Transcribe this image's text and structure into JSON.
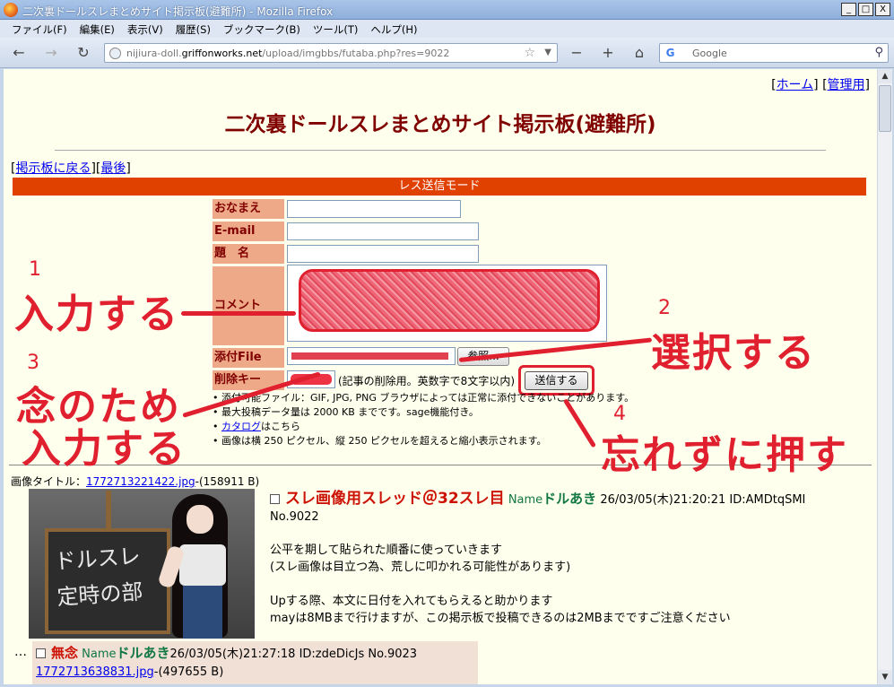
{
  "window": {
    "title": "二次裏ドールスレまとめサイト掲示板(避難所) - Mozilla Firefox",
    "minimize": "_",
    "maximize": "□",
    "close": "X"
  },
  "menu": [
    "ファイル(F)",
    "編集(E)",
    "表示(V)",
    "履歴(S)",
    "ブックマーク(B)",
    "ツール(T)",
    "ヘルプ(H)"
  ],
  "nav": {
    "url_prefix": "nijiura-doll.",
    "url_host": "griffonworks.net",
    "url_path": "/upload/imgbbs/futaba.php?res=9022",
    "search_placeholder": "Google",
    "back": "←",
    "forward": "→",
    "reload": "↻",
    "zoom_out": "−",
    "zoom_in": "+",
    "home": "⌂"
  },
  "page": {
    "home_link": "ホーム",
    "admin_link": "管理用",
    "title": "二次裏ドールスレまとめサイト掲示板(避難所)",
    "back_link": "掲示板に戻る",
    "last_link": "最後",
    "mode_bar": "レス送信モード"
  },
  "form": {
    "name_label": "おなまえ",
    "email_label": "E-mail",
    "subject_label": "題　名",
    "comment_label": "コメント",
    "file_label": "添付File",
    "browse_button": "参照...",
    "password_label": "削除キー",
    "password_note": "(記事の削除用。英数字で8文字以内)",
    "submit_button": "送信する",
    "notes": [
      "添付可能ファイル：GIF, JPG, PNG ブラウザによっては正常に添付できないことがあります。",
      "最大投稿データ量は 2000 KB までです。sage機能付き。",
      "画像は横 250 ピクセル、縦 250 ピクセルを超えると縮小表示されます。"
    ],
    "catalog_link": "カタログ",
    "catalog_suffix": "はこちら"
  },
  "thread": {
    "image_title_label": "画像タイトル：",
    "image_file": "1772713221422.jpg",
    "image_size": "-(158911 B)",
    "thumb_text_1": "ドルスレ",
    "thumb_text_2": "定時の部",
    "post_title": "スレ画像用スレッド＠32スレ目",
    "name_label": "Name",
    "name": "ドルあき",
    "datetime": "26/03/05(木)21:20:21 ID:AMDtqSMI",
    "number": "No.9022",
    "body": [
      "公平を期して貼られた順番に使っていきます",
      "(スレ画像は目立つ為、荒しに叩かれる可能性があります)",
      "",
      "Upする際、本文に日付を入れてもらえると助かります",
      "mayは8MBまで行けますが、この掲示板で投稿できるのは2MBまでですご注意ください"
    ]
  },
  "reply": {
    "marker": "…",
    "title": "無念",
    "name_label": "Name",
    "name": "ドルあき",
    "meta": "26/03/05(木)21:27:18 ID:zdeDicJs No.9023",
    "file": "1772713638831.jpg",
    "file_size": "-(497655 B)"
  },
  "annotations": {
    "n1": "1",
    "n2": "2",
    "n3": "3",
    "n4": "4",
    "a1": "入力する",
    "a2": "選択する",
    "a3_line1": "念のため",
    "a3_line2": "入力する",
    "a4": "忘れずに押す"
  },
  "colors": {
    "accent_red": "#e0202f",
    "mode_bar": "#e04000",
    "label_bg": "#eeaa88",
    "page_bg": "#ffffee",
    "title": "#800000"
  }
}
